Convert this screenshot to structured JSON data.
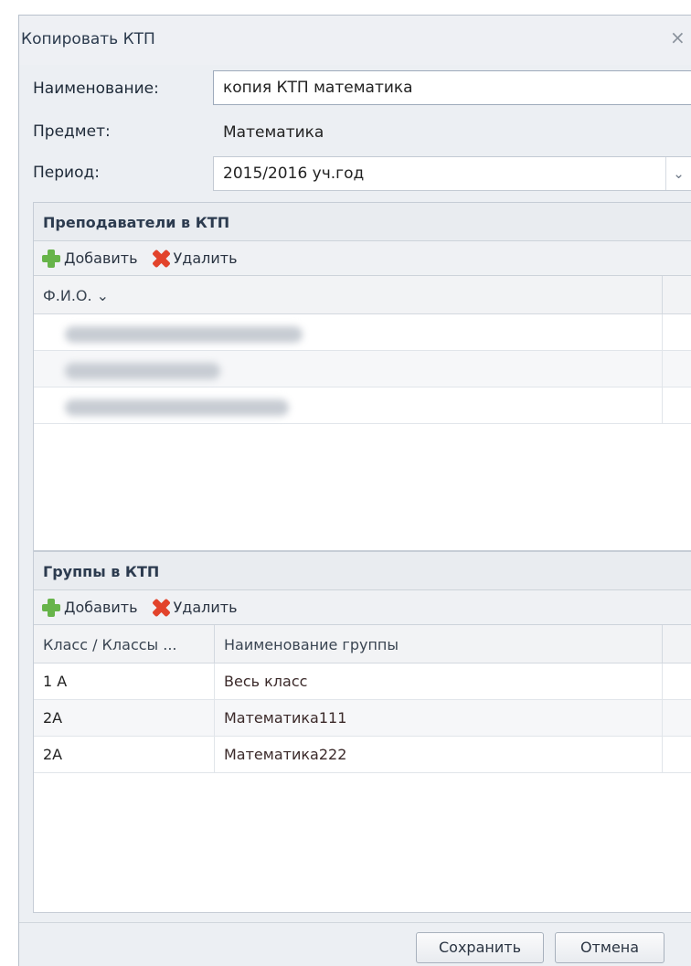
{
  "dialog": {
    "title": "Копировать КТП",
    "close_glyph": "×"
  },
  "form": {
    "name_label": "Наименование:",
    "name_value": "копия КТП математика",
    "subject_label": "Предмет:",
    "subject_value": "Математика",
    "period_label": "Период:",
    "period_value": "2015/2016 уч.год",
    "period_arrow": "⌄"
  },
  "teachers": {
    "header": "Преподаватели в КТП",
    "add_label": "Добавить",
    "delete_label": "Удалить",
    "column": "Ф.И.О. ⌄",
    "rows": [
      "",
      "",
      ""
    ]
  },
  "groups": {
    "header": "Группы в КТП",
    "add_label": "Добавить",
    "delete_label": "Удалить",
    "columns": [
      "Класс / Классы ...",
      "Наименование группы"
    ],
    "rows": [
      {
        "class": "1 А",
        "name": "Весь класс"
      },
      {
        "class": "2А",
        "name": "Математика111"
      },
      {
        "class": "2А",
        "name": "Математика222"
      }
    ]
  },
  "footer": {
    "save_label": "Сохранить",
    "cancel_label": "Отмена"
  },
  "icons": {
    "add": "plus-icon",
    "delete": "x-icon",
    "close": "close-icon"
  }
}
